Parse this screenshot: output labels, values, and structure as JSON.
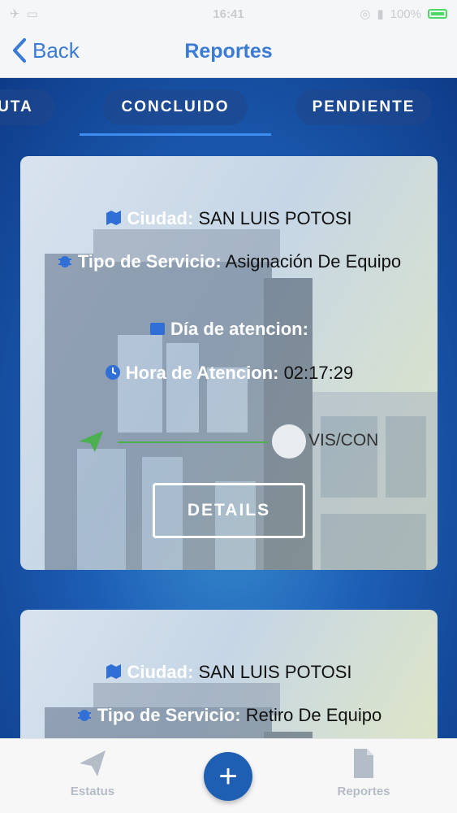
{
  "status_bar": {
    "time": "16:41",
    "battery": "100%"
  },
  "nav": {
    "back_label": "Back",
    "title": "Reportes"
  },
  "tabs": [
    {
      "label": "UTA"
    },
    {
      "label": "CONCLUIDO",
      "selected": true
    },
    {
      "label": "PENDIENTE"
    }
  ],
  "cards": [
    {
      "ciudad_label": "Ciudad:",
      "ciudad": "SAN LUIS POTOSI",
      "servicio_label": "Tipo de Servicio:",
      "servicio": "Asignación De Equipo",
      "dia_label": "Día de atencion:",
      "dia": "",
      "hora_label": "Hora de Atencion:",
      "hora": "02:17:29",
      "slider_label": "VIS/CON",
      "details_label": "DETAILS"
    },
    {
      "ciudad_label": "Ciudad:",
      "ciudad": "SAN LUIS POTOSI",
      "servicio_label": "Tipo de Servicio:",
      "servicio": "Retiro De Equipo"
    }
  ],
  "tabbar": {
    "left_label": "Estatus",
    "right_label": "Reportes",
    "fab_icon": "plus-icon"
  },
  "colors": {
    "accent": "#3a7bd5",
    "fab": "#1f5fb3",
    "slider_track": "#4caf50"
  }
}
